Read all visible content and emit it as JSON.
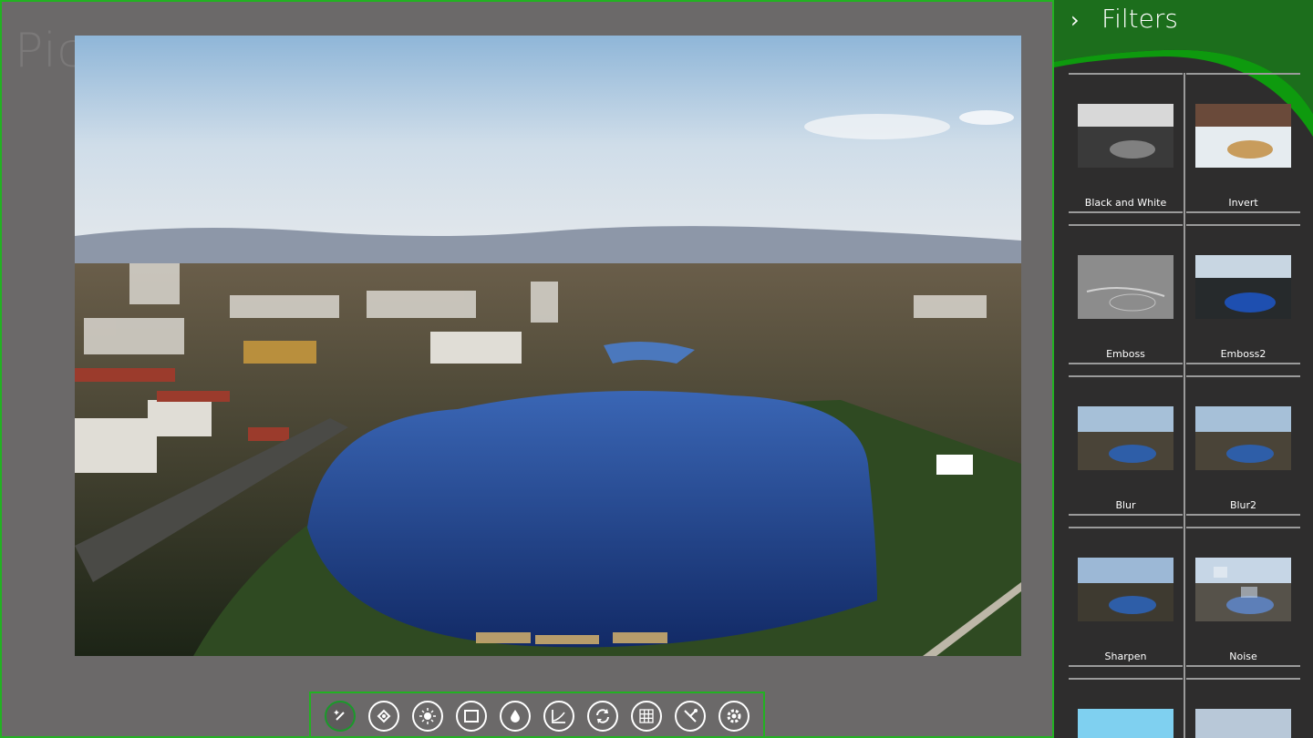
{
  "app": {
    "ghost_title": "Pic"
  },
  "panel": {
    "title": "Filters",
    "back_icon": "chevron-right-icon"
  },
  "filters": [
    {
      "label": "Black and White",
      "icon": "bw-thumb"
    },
    {
      "label": "Invert",
      "icon": "invert-thumb"
    },
    {
      "label": "Emboss",
      "icon": "emboss-thumb"
    },
    {
      "label": "Emboss2",
      "icon": "emboss2-thumb"
    },
    {
      "label": "Blur",
      "icon": "blur-thumb"
    },
    {
      "label": "Blur2",
      "icon": "blur2-thumb"
    },
    {
      "label": "Sharpen",
      "icon": "sharpen-thumb"
    },
    {
      "label": "Noise",
      "icon": "noise-thumb"
    }
  ],
  "toolbar": {
    "tools": [
      {
        "name": "magic-wand-icon",
        "active": true
      },
      {
        "name": "crop-rotate-icon"
      },
      {
        "name": "brightness-icon"
      },
      {
        "name": "crop-icon"
      },
      {
        "name": "water-drop-icon"
      },
      {
        "name": "curves-icon"
      },
      {
        "name": "rotate-icon"
      },
      {
        "name": "grid-icon"
      },
      {
        "name": "tools-icon"
      },
      {
        "name": "settings-icon"
      }
    ]
  },
  "colors": {
    "accent": "#22b222",
    "panel_bg": "#2e2d2d",
    "canvas_bg": "#6b6969",
    "header_green": "#1c6e1c"
  }
}
